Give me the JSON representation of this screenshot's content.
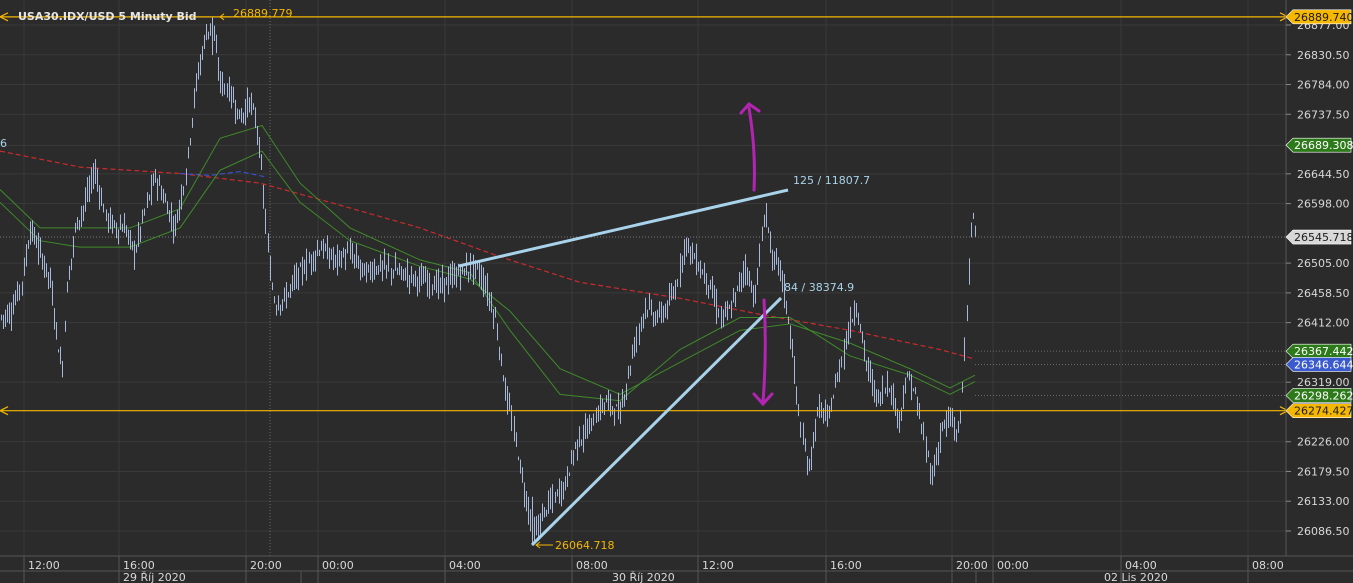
{
  "window": {
    "title": "USA30.IDX/USD  5 Minuty Bid"
  },
  "colors": {
    "background": "#2b2b2b",
    "grid": "#3a3a3a",
    "candle": "#a7b9db",
    "level_line": "#f5b700",
    "trendline": "#a9d3ea",
    "ma_long": "#cc2a2a",
    "ma_blue": "#3a4fd0",
    "ma_green": "#3f8a2a",
    "arrow": "#b324b3",
    "badge_orange": "#f5b700",
    "badge_green": "#2d7a1a",
    "badge_blue": "#3a5ad0",
    "badge_gray": "#d8d8d8"
  },
  "price_axis": {
    "ticks": [
      "26877.00",
      "26830.50",
      "26784.00",
      "26737.50",
      "26689.00",
      "26644.50",
      "26598.00",
      "26505.00",
      "26458.50",
      "26412.00",
      "26319.00",
      "26226.00",
      "26179.50",
      "26133.00",
      "26086.50"
    ]
  },
  "price_badges": [
    {
      "label": "26889.740",
      "color": "orange"
    },
    {
      "label": "26689.308",
      "color": "green"
    },
    {
      "label": "26545.718",
      "color": "gray"
    },
    {
      "label": "26367.442",
      "color": "green"
    },
    {
      "label": "26346.644",
      "color": "blue"
    },
    {
      "label": "26298.262",
      "color": "green"
    },
    {
      "label": "26274.427",
      "color": "orange"
    }
  ],
  "time_axis": {
    "ticks": [
      "12:00",
      "16:00",
      "20:00",
      "00:00",
      "04:00",
      "08:00",
      "12:00",
      "16:00",
      "20:00",
      "00:00",
      "04:00",
      "08:00"
    ],
    "dates": [
      "29 Říj 2020",
      "30 Říj 2020",
      "02 Lis 2020"
    ]
  },
  "annotations": {
    "high_label": "26889.779",
    "low_label": "26064.718",
    "upper_trendline_label": "125 / 11807.7",
    "lower_trendline_label": "84 / 38374.9",
    "left_edge_label": "6"
  }
}
